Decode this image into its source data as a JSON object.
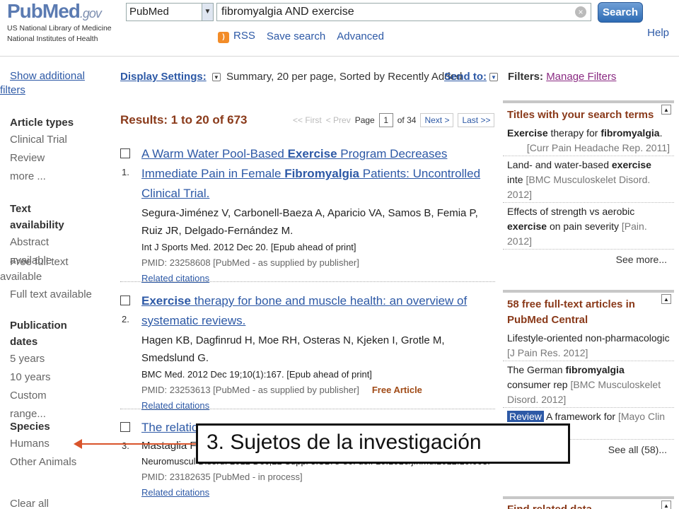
{
  "header": {
    "logo": "PubMed",
    "logo_gov": ".gov",
    "logo_sub1": "US National Library of Medicine",
    "logo_sub2": "National Institutes of Health",
    "database": "PubMed",
    "query": "fibromyalgia AND exercise",
    "search_label": "Search",
    "rss": "RSS",
    "save_search": "Save search",
    "advanced": "Advanced",
    "help": "Help"
  },
  "sidebar": {
    "show_filters": "Show additional filters",
    "article_types": {
      "head": "Article types",
      "items": [
        "Clinical Trial",
        "Review",
        "more ..."
      ]
    },
    "text_availability": {
      "head": "Text availability",
      "items": [
        "Abstract available",
        "Free full text available",
        "Full text available"
      ]
    },
    "publication_dates": {
      "head": "Publication dates",
      "items": [
        "5 years",
        "10 years",
        "Custom range..."
      ]
    },
    "species": {
      "head": "Species",
      "items": [
        "Humans",
        "Other Animals"
      ]
    },
    "clear_all": "Clear all"
  },
  "display": {
    "label": "Display Settings:",
    "value": "Summary, 20 per page, Sorted by Recently Added",
    "send_to": "Send to:"
  },
  "results": {
    "title": "Results: 1 to 20 of 673",
    "pager": {
      "first": "<< First",
      "prev": "< Prev",
      "page_label": "Page",
      "page": "1",
      "of": "of 34",
      "next": "Next >",
      "last": "Last >>"
    },
    "items": [
      {
        "num": "1.",
        "title_a": "A Warm Water Pool-Based ",
        "title_b": "Exercise",
        "title_c": " Program Decreases Immediate Pain in Female ",
        "title_d": "Fibromyalgia",
        "title_e": " Patients: Uncontrolled Clinical Trial.",
        "authors": "Segura-Jiménez V, Carbonell-Baeza A, Aparicio VA, Samos B, Femia P, Ruiz JR, Delgado-Fernández M.",
        "source": "Int J Sports Med. 2012 Dec 20. [Epub ahead of print]",
        "pmid": "PMID: 23258608 [PubMed - as supplied by publisher]",
        "free": "",
        "related": "Related citations"
      },
      {
        "num": "2.",
        "title_a": "",
        "title_b": "Exercise",
        "title_c": " therapy for bone and muscle health: an overview of systematic reviews.",
        "title_d": "",
        "title_e": "",
        "authors": "Hagen KB, Dagfinrud H, Moe RH, Osteras N, Kjeken I, Grotle M, Smedslund G.",
        "source": "BMC Med. 2012 Dec 19;10(1):167. [Epub ahead of print]",
        "pmid": "PMID: 23253613 [PubMed - as supplied by publisher]",
        "free": "Free Article",
        "related": "Related citations"
      },
      {
        "num": "3.",
        "title_a": "The relation",
        "authors": "Mastaglia FL",
        "source": "Neuromuscul Disord. 2012 Dec;22 Suppl 3:S178-80. doi: 10.1016/j.nmd.2012.10.003.",
        "pmid": "PMID: 23182635 [PubMed - in process]",
        "related": "Related citations"
      }
    ]
  },
  "right": {
    "filters_label": "Filters:",
    "manage_filters": "Manage Filters",
    "titles_box": {
      "head": "Titles with your search terms",
      "items": [
        {
          "b1": "Exercise",
          "t1": " therapy for ",
          "b2": "fibromyalgia",
          "t2": ".",
          "ref": "[Curr Pain Headache Rep. 2011]"
        },
        {
          "b1": "",
          "t1": "Land- and water-based ",
          "b2": "exercise",
          "t2": " inte",
          "ref": "[BMC Musculoskelet Disord. 2012]"
        },
        {
          "b1": "",
          "t1": "Effects of strength vs aerobic ",
          "b2": "exercise",
          "t2": " on pain severity",
          "ref": "[Pain. 2012]"
        }
      ],
      "more": "See more..."
    },
    "free_box": {
      "head": "58 free full-text articles in PubMed Central",
      "items": [
        {
          "t1": "Lifestyle-oriented non-pharmacologic",
          "ref": "[J Pain Res. 2012]"
        },
        {
          "t1": "The German ",
          "b": "fibromyalgia",
          "t2": " consumer rep",
          "ref": "[BMC Musculoskelet Disord. 2012]"
        },
        {
          "tag": "Review",
          "t1": " A framework for",
          "ref": "[Mayo Clin Proc. 2012]"
        }
      ],
      "more": "See all (58)..."
    },
    "related_box": {
      "head": "Find related data"
    }
  },
  "overlay": {
    "text": "3. Sujetos de la investigación"
  },
  "colors": {
    "link": "#2d59a6",
    "heading_brown": "#8a3a1a",
    "arrow": "#d9542b"
  }
}
